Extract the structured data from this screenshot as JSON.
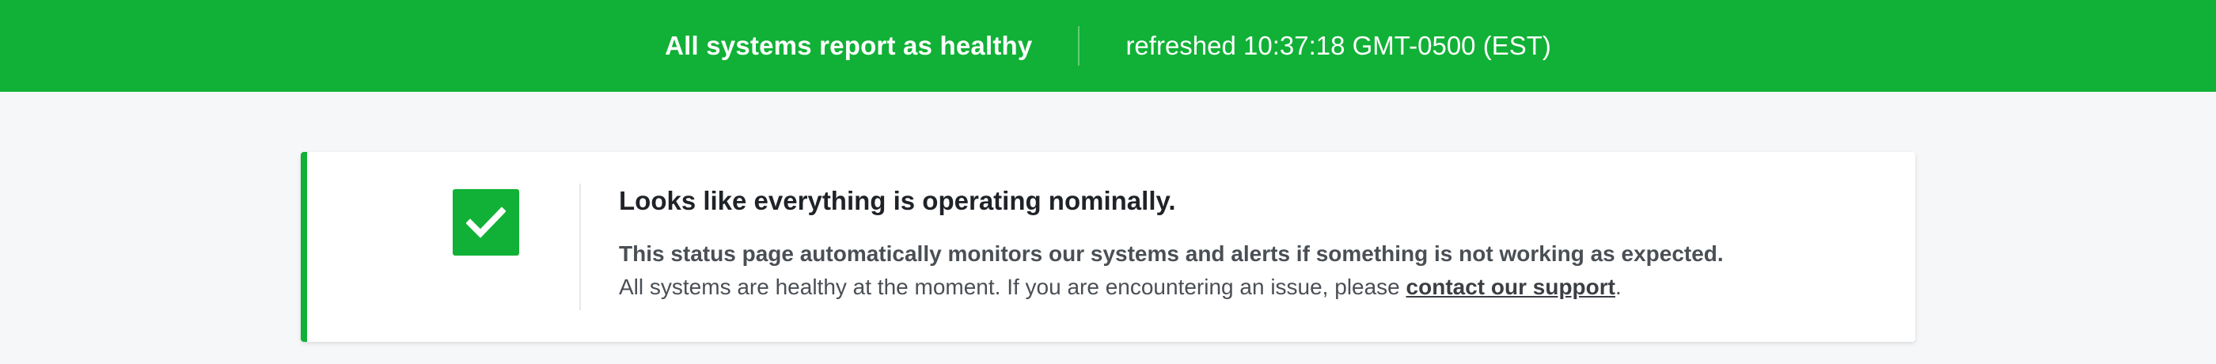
{
  "header": {
    "status_text": "All systems report as healthy",
    "refreshed_text": "refreshed 10:37:18 GMT-0500 (EST)",
    "background_color": "#10b136"
  },
  "status_card": {
    "icon": "check-icon",
    "headline": "Looks like everything is operating nominally.",
    "line1": "This status page automatically monitors our systems and alerts if something is not working as expected.",
    "line2_prefix": "All systems are healthy at the moment. If you are encountering an issue, please ",
    "support_link": "contact our support",
    "line2_suffix": ".",
    "accent_color": "#10b136"
  }
}
